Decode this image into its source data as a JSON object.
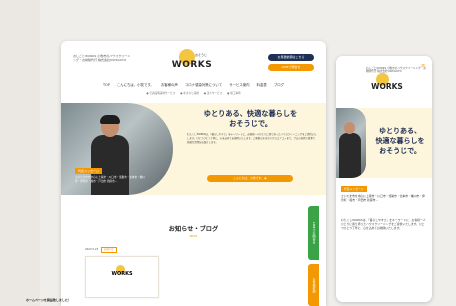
{
  "desktop": {
    "brand_sub": "おしごとWORKS 小牧市のハウスクリーニング・お掃除代行 株式会社OSHIGOTO",
    "logo_small": "おそうじ",
    "logo_word": "WORKS",
    "contact_button": "お見積依頼はこちら",
    "line_button": "LINEで問合せ",
    "nav": [
      "TOP",
      "こんにちは、小牧です。",
      "お客様の声",
      "コロナ感染対策について",
      "サービス案内",
      "料金表",
      "ブログ"
    ],
    "subnav": [
      "● 空調設備清掃サービス",
      "● 水まわり清掃",
      "● 法人サービス",
      "● 施工事例"
    ],
    "hero_tag": "代表メッセージ",
    "hero_photo_caption": "さいたま市を中心に上尾市・川口市・鴻巣市・北本市・桶川市・伊奈町・蕨市・戸田市 新座市…",
    "hero_title_line1": "ゆとりある、快適な暮らしを",
    "hero_title_line2": "おそうじで。",
    "hero_body": "わたくしWORKSは、「暮らしやすさ」をキーワードに、お客様一人ひとりに寄り添ったハウスクリーニングをご提供いたします。ひとつひとつ丁寧に、心を込めてお掃除いたします。ご家庭の水まわりからエアコンまで、プロの技術で清潔で快適な空間をお届けします。",
    "hero_button": "こんにちは、小牧です。 ▶",
    "news_title": "お知らせ・ブログ",
    "news_en": "NEWS",
    "news_date": "2022.5.23",
    "news_badge": "お知らせ",
    "news_card_word": "WORKS",
    "news_item_title": "ホームページを開設致しました！",
    "side_tab_green": "LINEでお問合せ",
    "side_tab_orange": "お見積依頼"
  },
  "mobile": {
    "brand_sub": "おしごとWORKS 小牧市のハウスクリーニング・お掃除代行 株式会社OSHIGOTO",
    "logo_word": "WORKS",
    "menu_icon": "≡",
    "title_line1": "ゆとりある、",
    "title_line2": "快適な暮らしを",
    "title_line3": "おそうじで。",
    "tag": "代表メッセージ",
    "caption": "さいたま市を中心に上尾市・川口市・鴻巣市・北本市・桶川市・伊奈町・蕨市・戸田市 新座市…",
    "body": "わたくしWORKSは、「暮らしやすさ」をキーワードに、お客様一人ひとりに寄り添ったハウスクリーニングをご提供いたします。ひとつひとつ丁寧に、心を込めてお掃除いたします。"
  }
}
